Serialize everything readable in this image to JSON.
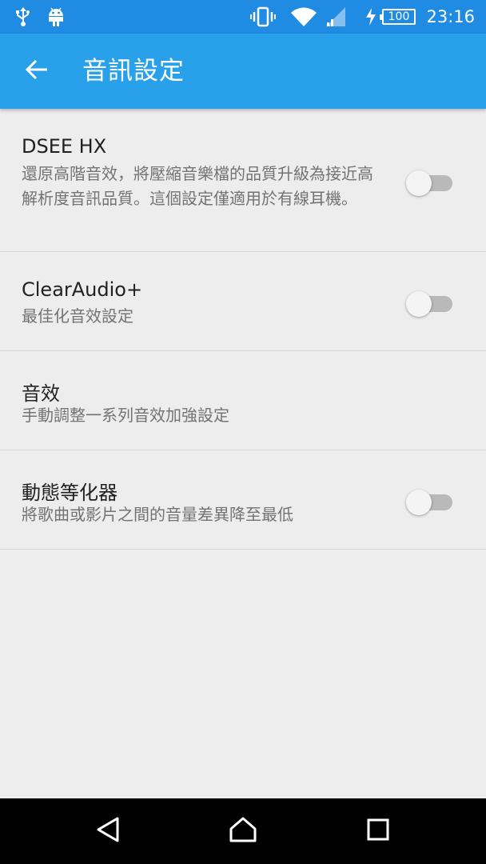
{
  "status_bar": {
    "time": "23:16",
    "battery_level": "100",
    "icons": [
      "usb-icon",
      "android-icon",
      "vibrate-icon",
      "wifi-icon",
      "cell-signal-icon",
      "charging-icon",
      "battery-icon"
    ]
  },
  "app_bar": {
    "title": "音訊設定",
    "back_icon": "arrow-back-icon"
  },
  "settings": [
    {
      "title": "DSEE HX",
      "summary": "還原高階音效，將壓縮音樂檔的品質升級為接近高解析度音訊品質。這個設定僅適用於有線耳機。",
      "toggle": false
    },
    {
      "title": "ClearAudio+",
      "summary": "最佳化音效設定",
      "toggle": false
    },
    {
      "title": "音效",
      "summary": "手動調整一系列音效加強設定"
    },
    {
      "title": "動態等化器",
      "summary": "將歌曲或影片之間的音量差異降至最低",
      "toggle": false
    }
  ],
  "nav_bar": {
    "buttons": [
      "back-triangle-icon",
      "home-icon",
      "recents-icon"
    ]
  },
  "colors": {
    "status_bar": "#1f8be3",
    "app_bar": "#28a0ea",
    "background": "#ededed",
    "divider": "#d6d6d6"
  }
}
